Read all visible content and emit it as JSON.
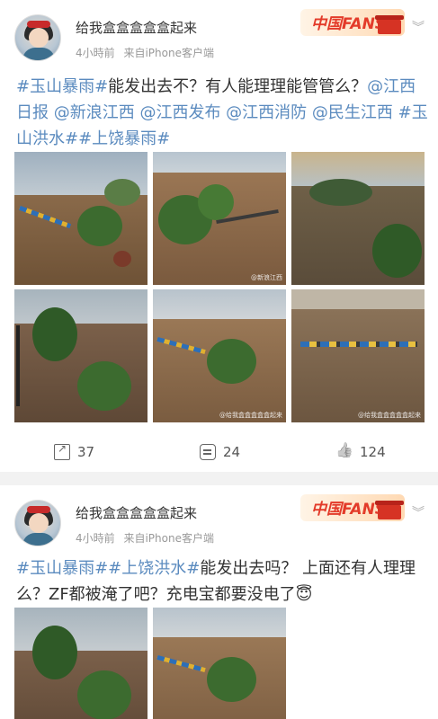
{
  "posts": [
    {
      "username": "给我盒盒盒盒盒起来",
      "time": "4小時前",
      "source": "来自iPhone客户端",
      "badge": "中国FANS",
      "text_parts": [
        {
          "t": "#玉山暴雨#",
          "tag": true
        },
        {
          "t": "能发出去不？有人能理理能管管么？",
          "tag": false
        },
        {
          "t": "@江西日报 @新浪江西 @江西发布 @江西消防 @民生江西 #玉山洪水##上饶暴雨#",
          "tag": true
        }
      ],
      "images": [
        {
          "watermark": ""
        },
        {
          "watermark": "@新浪江西"
        },
        {
          "watermark": ""
        },
        {
          "watermark": ""
        },
        {
          "watermark": "@给我盒盒盒盒盒起来"
        },
        {
          "watermark": "@给我盒盒盒盒盒起来"
        }
      ],
      "reposts": "37",
      "comments": "24",
      "likes": "124"
    },
    {
      "username": "给我盒盒盒盒盒起来",
      "time": "4小時前",
      "source": "来自iPhone客户端",
      "badge": "中国FANS",
      "text_parts": [
        {
          "t": "#玉山暴雨##上饶洪水#",
          "tag": true
        },
        {
          "t": "能发出去吗？ 上面还有人理理么？ZF都被淹了吧？充电宝都要没电了😇",
          "tag": false
        }
      ]
    }
  ],
  "icons": {
    "share": "share-icon",
    "comment": "comment-icon",
    "like": "like-icon",
    "more": "chevron-down-icon"
  },
  "colors": {
    "tag": "#5b8bbf",
    "badge_red": "#e33b2a"
  }
}
